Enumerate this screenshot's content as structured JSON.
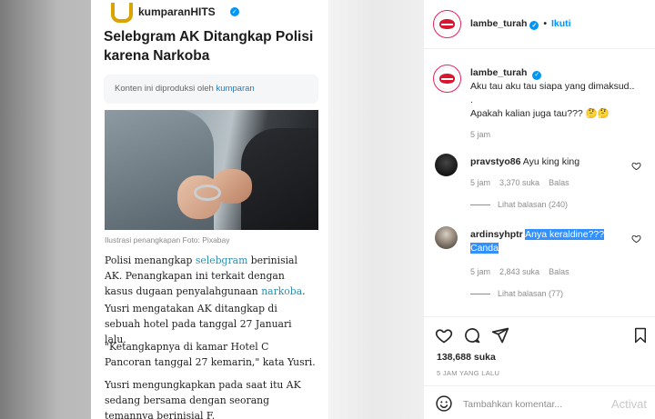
{
  "post": {
    "brand": "kumparanHITS",
    "headline": "Selebgram AK Ditangkap Polisi karena Narkoba",
    "produced_prefix": "Konten ini diproduksi oleh ",
    "produced_link": "kumparan",
    "photo_caption": "Ilustrasi penangkapan Foto: Pixabay",
    "p1_a": "Polisi menangkap ",
    "p1_link1": "selebgram",
    "p1_b": " berinisial AK. Penangkapan ini terkait dengan kasus dugaan penyalahgunaan ",
    "p1_link2": "narkoba",
    "p1_c": ".",
    "p2": "Yusri mengatakan AK ditangkap di sebuah hotel pada tanggal 27 Januari lalu.",
    "p3": "\"Ketangkapnya di kamar Hotel C Pancoran tanggal 27 kemarin,\" kata Yusri.",
    "p4": "Yusri mengungkapkan pada saat itu AK sedang bersama dengan seorang temannya berinisial F."
  },
  "header": {
    "username": "lambe_turah",
    "verified": "✓",
    "separator": "•",
    "follow": "Ikuti"
  },
  "caption": {
    "username": "lambe_turah",
    "line1": "Aku tau aku tau siapa yang dimaksud..",
    "line2": ".",
    "line3": "Apakah kalian juga tau???",
    "emoji": "🤔🤔",
    "time": "5 jam"
  },
  "comments": [
    {
      "username": "pravstyo86",
      "text": "Ayu king king",
      "time": "5 jam",
      "likes": "3,370 suka",
      "reply": "Balas",
      "view_replies": "Lihat balasan (240)"
    },
    {
      "username": "ardinsyhptr",
      "text_selected_1": "Anya keraldine???",
      "text_selected_2": "Canda",
      "time": "5 jam",
      "likes": "2,843 suka",
      "reply": "Balas",
      "view_replies": "Lihat balasan (77)"
    }
  ],
  "actions": {
    "likes": "138,688 suka",
    "time_ago": "5 JAM YANG LALU"
  },
  "add_comment": {
    "placeholder": "Tambahkan komentar...",
    "watermark": "Activat"
  }
}
